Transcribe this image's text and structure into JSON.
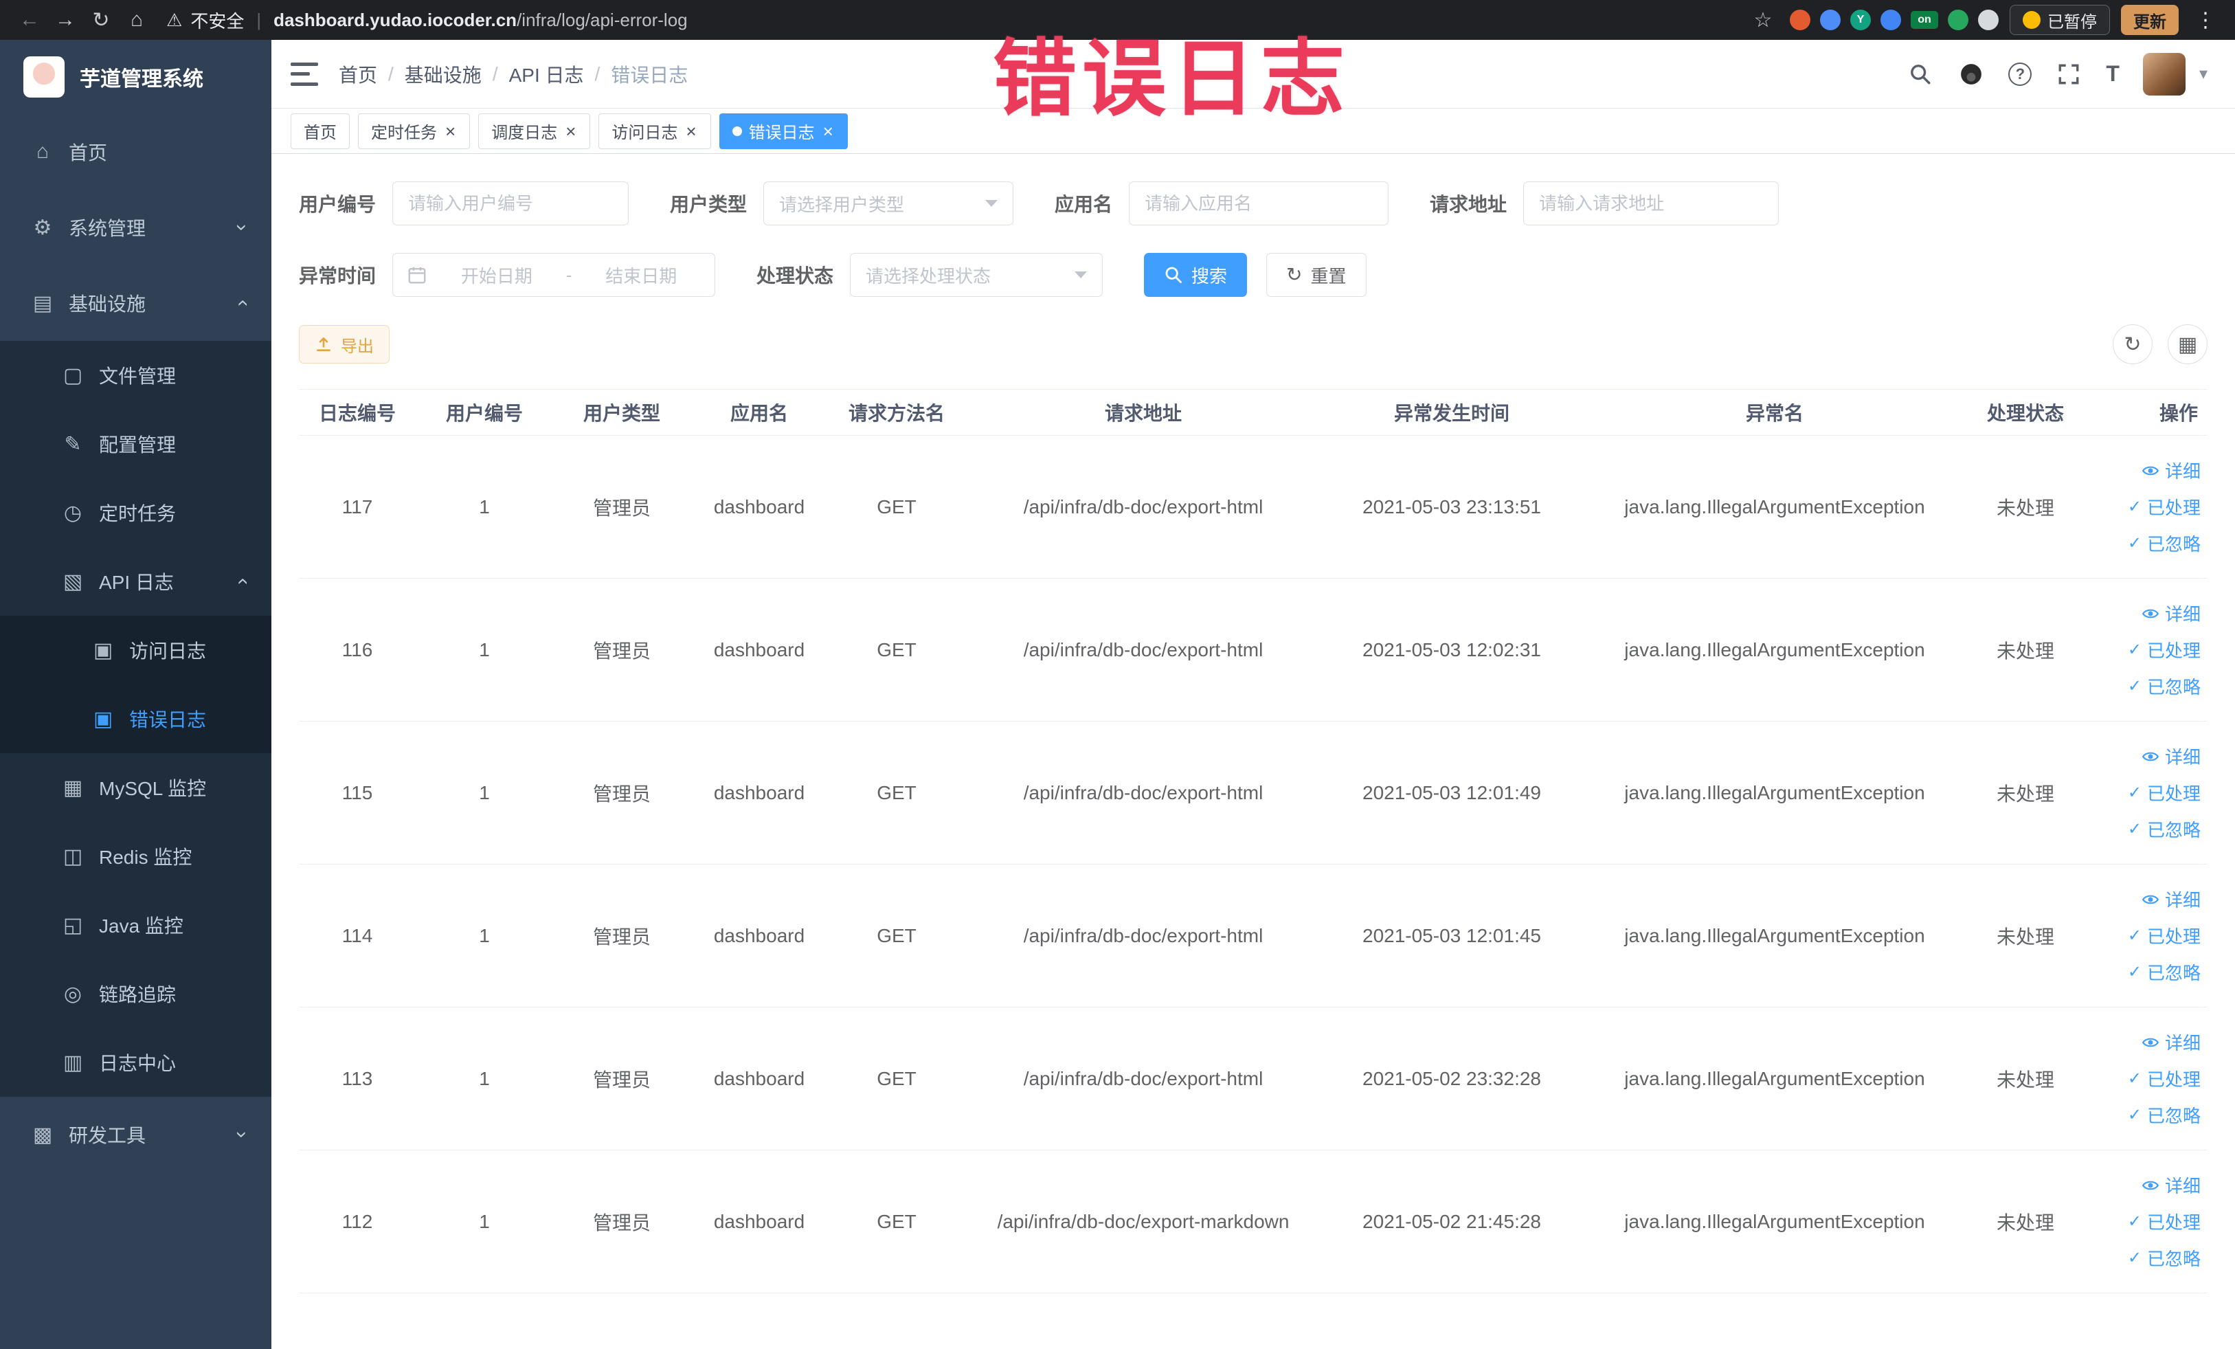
{
  "colors": {
    "accent": "#409eff",
    "warning": "#e6a23c",
    "annotation": "#ea3b5b",
    "sidebar_bg": "#304156",
    "submenu_bg": "#1f2d3d"
  },
  "annotation": {
    "text": "错误日志"
  },
  "browser": {
    "security": "不安全",
    "url_host": "dashboard.yudao.iocoder.cn",
    "url_path": "/infra/log/api-error-log",
    "paused": "已暂停",
    "update": "更新",
    "extensions": [
      {
        "name": "extension-icon",
        "color": "#e35b2e",
        "label": ""
      },
      {
        "name": "extension-icon",
        "color": "#4e8cf7",
        "label": ""
      },
      {
        "name": "extension-icon",
        "color": "#12a383",
        "label": "Y"
      },
      {
        "name": "extension-icon",
        "color": "#4285f4",
        "label": ""
      },
      {
        "name": "extension-icon",
        "color": "#0b8043",
        "label": "on",
        "shape": "badge"
      },
      {
        "name": "extension-icon",
        "color": "#27a85f",
        "label": ""
      },
      {
        "name": "extension-icon",
        "color": "#d7dadd",
        "label": ""
      }
    ]
  },
  "icons": {
    "back-icon": "←",
    "forward-icon": "→",
    "reload-icon": "↻",
    "home-icon": "⌂",
    "warning-icon": "⚠",
    "star-icon": "☆",
    "more-icon": "⋮",
    "caret-down-icon": "▾",
    "question-mark": "?",
    "font-size-icon": "T",
    "grid-icon": "▦",
    "refresh-icon": "↻",
    "check-icon": "✓"
  },
  "menu_icons": {
    "home-icon": "⌂",
    "gear-icon": "⚙",
    "infra-icon": "▤",
    "file-icon": "▢",
    "config-icon": "✎",
    "timer-icon": "◷",
    "api-log-icon": "▧",
    "doc-icon": "▣",
    "mysql-icon": "▦",
    "redis-icon": "◫",
    "java-icon": "◱",
    "trace-icon": "◎",
    "log-center-icon": "▥",
    "tools-icon": "▩"
  },
  "sidebar": {
    "title": "芋道管理系统",
    "menu": [
      {
        "key": "home",
        "label": "首页",
        "icon": "home-icon",
        "level": 1,
        "type": "item"
      },
      {
        "key": "system",
        "label": "系统管理",
        "icon": "gear-icon",
        "level": 1,
        "type": "group",
        "arrow": "down"
      },
      {
        "key": "infra",
        "label": "基础设施",
        "icon": "infra-icon",
        "level": 1,
        "type": "group",
        "arrow": "up"
      },
      {
        "key": "file",
        "label": "文件管理",
        "icon": "file-icon",
        "level": 2,
        "type": "item"
      },
      {
        "key": "config",
        "label": "配置管理",
        "icon": "config-icon",
        "level": 2,
        "type": "item"
      },
      {
        "key": "job",
        "label": "定时任务",
        "icon": "timer-icon",
        "level": 2,
        "type": "item"
      },
      {
        "key": "api-log",
        "label": "API 日志",
        "icon": "api-log-icon",
        "level": 2,
        "type": "group",
        "arrow": "up"
      },
      {
        "key": "access-log",
        "label": "访问日志",
        "icon": "doc-icon",
        "level": 3,
        "type": "item"
      },
      {
        "key": "error-log",
        "label": "错误日志",
        "icon": "doc-icon",
        "level": 3,
        "type": "item",
        "active": true
      },
      {
        "key": "mysql",
        "label": "MySQL 监控",
        "icon": "mysql-icon",
        "level": 2,
        "type": "item"
      },
      {
        "key": "redis",
        "label": "Redis 监控",
        "icon": "redis-icon",
        "level": 2,
        "type": "item"
      },
      {
        "key": "java",
        "label": "Java 监控",
        "icon": "java-icon",
        "level": 2,
        "type": "item"
      },
      {
        "key": "trace",
        "label": "链路追踪",
        "icon": "trace-icon",
        "level": 2,
        "type": "item"
      },
      {
        "key": "log-center",
        "label": "日志中心",
        "icon": "log-center-icon",
        "level": 2,
        "type": "item"
      },
      {
        "key": "dev-tools",
        "label": "研发工具",
        "icon": "tools-icon",
        "level": 1,
        "type": "group",
        "arrow": "down"
      }
    ]
  },
  "header": {
    "breadcrumb": [
      "首页",
      "基础设施",
      "API 日志",
      "错误日志"
    ],
    "breadcrumb_separator": "/"
  },
  "tabs": [
    {
      "key": "home",
      "label": "首页",
      "closable": false,
      "active": false
    },
    {
      "key": "job",
      "label": "定时任务",
      "closable": true,
      "active": false
    },
    {
      "key": "job-log",
      "label": "调度日志",
      "closable": true,
      "active": false
    },
    {
      "key": "access-log",
      "label": "访问日志",
      "closable": true,
      "active": false
    },
    {
      "key": "error-log",
      "label": "错误日志",
      "closable": true,
      "active": true
    }
  ],
  "filters": {
    "user_id": {
      "label": "用户编号",
      "placeholder": "请输入用户编号"
    },
    "user_type": {
      "label": "用户类型",
      "placeholder": "请选择用户类型"
    },
    "app_name": {
      "label": "应用名",
      "placeholder": "请输入应用名"
    },
    "request_url": {
      "label": "请求地址",
      "placeholder": "请输入请求地址"
    },
    "exception_time": {
      "label": "异常时间",
      "start_placeholder": "开始日期",
      "separator": "-",
      "end_placeholder": "结束日期"
    },
    "process_status": {
      "label": "处理状态",
      "placeholder": "请选择处理状态"
    },
    "search": "搜索",
    "reset": "重置"
  },
  "toolbar": {
    "export": "导出"
  },
  "glyphs": {
    "close": "×",
    "chevron": "›",
    "dot": "●"
  },
  "table": {
    "columns": [
      "日志编号",
      "用户编号",
      "用户类型",
      "应用名",
      "请求方法名",
      "请求地址",
      "异常发生时间",
      "异常名",
      "处理状态",
      "操作"
    ],
    "actions": {
      "detail": "详细",
      "process": "已处理",
      "ignore": "已忽略"
    },
    "rows": [
      {
        "id": "117",
        "user_id": "1",
        "user_type": "管理员",
        "app": "dashboard",
        "method": "GET",
        "url": "/api/infra/db-doc/export-html",
        "time": "2021-05-03 23:13:51",
        "exception": "java.lang.IllegalArgumentException",
        "status": "未处理"
      },
      {
        "id": "116",
        "user_id": "1",
        "user_type": "管理员",
        "app": "dashboard",
        "method": "GET",
        "url": "/api/infra/db-doc/export-html",
        "time": "2021-05-03 12:02:31",
        "exception": "java.lang.IllegalArgumentException",
        "status": "未处理"
      },
      {
        "id": "115",
        "user_id": "1",
        "user_type": "管理员",
        "app": "dashboard",
        "method": "GET",
        "url": "/api/infra/db-doc/export-html",
        "time": "2021-05-03 12:01:49",
        "exception": "java.lang.IllegalArgumentException",
        "status": "未处理"
      },
      {
        "id": "114",
        "user_id": "1",
        "user_type": "管理员",
        "app": "dashboard",
        "method": "GET",
        "url": "/api/infra/db-doc/export-html",
        "time": "2021-05-03 12:01:45",
        "exception": "java.lang.IllegalArgumentException",
        "status": "未处理"
      },
      {
        "id": "113",
        "user_id": "1",
        "user_type": "管理员",
        "app": "dashboard",
        "method": "GET",
        "url": "/api/infra/db-doc/export-html",
        "time": "2021-05-02 23:32:28",
        "exception": "java.lang.IllegalArgumentException",
        "status": "未处理"
      },
      {
        "id": "112",
        "user_id": "1",
        "user_type": "管理员",
        "app": "dashboard",
        "method": "GET",
        "url": "/api/infra/db-doc/export-markdown",
        "time": "2021-05-02 21:45:28",
        "exception": "java.lang.IllegalArgumentException",
        "status": "未处理"
      }
    ]
  }
}
